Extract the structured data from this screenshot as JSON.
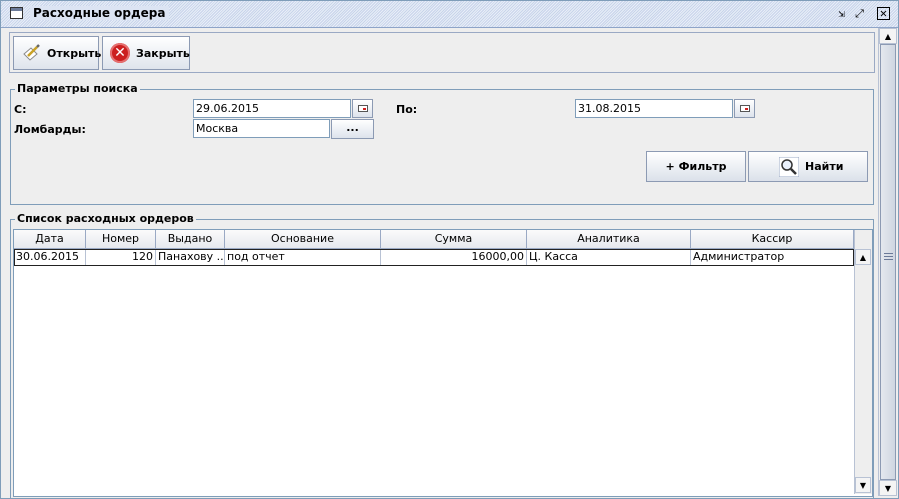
{
  "window": {
    "title": "Расходные ордера",
    "controls": {
      "minimize": "⇲",
      "maximize": "⤢",
      "close": "✕"
    }
  },
  "toolbar": {
    "open_label": "Открыть",
    "close_label": "Закрыть"
  },
  "search": {
    "legend": "Параметры поиска",
    "from_label": "С:",
    "from_value": "29.06.2015",
    "to_label": "По:",
    "to_value": "31.08.2015",
    "pawnshops_label": "Ломбарды:",
    "pawnshops_value": "Москва",
    "browse_label": "...",
    "filter_label": "+ Фильтр",
    "find_label": "Найти"
  },
  "orders": {
    "legend": "Список расходных ордеров",
    "columns": [
      "Дата",
      "Номер",
      "Выдано",
      "Основание",
      "Сумма",
      "Аналитика",
      "Кассир"
    ],
    "rows": [
      [
        "30.06.2015",
        "120",
        "Панахову ...",
        "под отчет",
        "16000,00",
        "Ц. Касса",
        "Администратор"
      ]
    ]
  },
  "icons": {
    "title": "window-icon",
    "open": "pencil-page-icon",
    "close": "red-x-icon",
    "calendar": "calendar-icon",
    "find": "magnifier-icon"
  },
  "colors": {
    "border": "#7f9db9",
    "titlebar": "#c8d4ea",
    "close_icon": "#cc1f1f"
  }
}
